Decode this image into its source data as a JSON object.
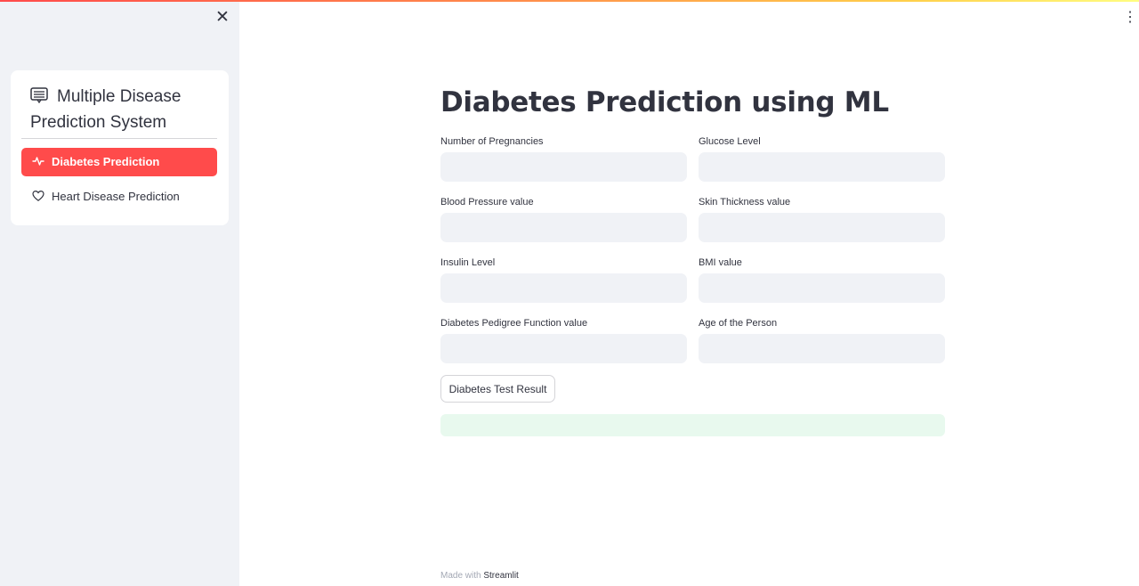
{
  "app": {
    "accent_color": "#ff4b4b",
    "sidebar_bg": "#f0f2f6"
  },
  "sidebar": {
    "close_icon": "close-icon",
    "menu": {
      "title_icon": "menu-app-icon",
      "title": "Multiple Disease Prediction System",
      "items": [
        {
          "label": "Diabetes Prediction",
          "icon": "activity-icon",
          "active": true
        },
        {
          "label": "Heart Disease Prediction",
          "icon": "heart-icon",
          "active": false
        }
      ]
    }
  },
  "header": {
    "menu_icon": "kebab-menu-icon"
  },
  "main": {
    "title": "Diabetes Prediction using ML",
    "fields": [
      {
        "label": "Number of Pregnancies",
        "value": ""
      },
      {
        "label": "Glucose Level",
        "value": ""
      },
      {
        "label": "Blood Pressure value",
        "value": ""
      },
      {
        "label": "Skin Thickness value",
        "value": ""
      },
      {
        "label": "Insulin Level",
        "value": ""
      },
      {
        "label": "BMI value",
        "value": ""
      },
      {
        "label": "Diabetes Pedigree Function value",
        "value": ""
      },
      {
        "label": "Age of the Person",
        "value": ""
      }
    ],
    "result_button_label": "Diabetes Test Result",
    "result_message": "",
    "result_color": "#e8f9ee"
  },
  "footer": {
    "prefix": "Made with",
    "brand": "Streamlit"
  }
}
